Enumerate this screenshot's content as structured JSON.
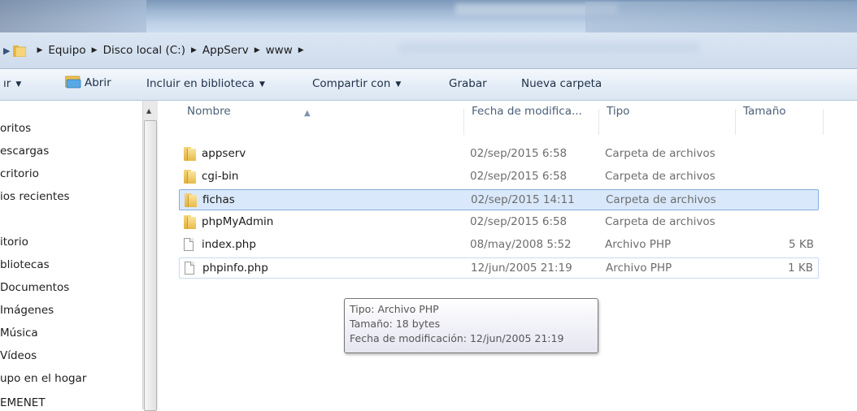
{
  "address": {
    "crumbs": [
      "Equipo",
      "Disco local (C:)",
      "AppServ",
      "www"
    ]
  },
  "toolbar": {
    "organize": "ır",
    "open": "Abrir",
    "include_library": "Incluir en biblioteca",
    "share_with": "Compartir con",
    "burn": "Grabar",
    "new_folder": "Nueva carpeta"
  },
  "nav": [
    "oritos",
    "escargas",
    "critorio",
    "ios recientes",
    "itorio",
    "bliotecas",
    "Documentos",
    "Imágenes",
    "Música",
    "Vídeos",
    "upo en el hogar",
    "EMENET"
  ],
  "columns": {
    "name": "Nombre",
    "date": "Fecha de modifica...",
    "type": "Tipo",
    "size": "Tamaño"
  },
  "files": [
    {
      "name": "appserv",
      "date": "02/sep/2015 6:58",
      "type": "Carpeta de archivos",
      "size": "",
      "icon": "folder-icon"
    },
    {
      "name": "cgi-bin",
      "date": "02/sep/2015 6:58",
      "type": "Carpeta de archivos",
      "size": "",
      "icon": "folder-icon"
    },
    {
      "name": "fichas",
      "date": "02/sep/2015 14:11",
      "type": "Carpeta de archivos",
      "size": "",
      "icon": "folder-icon"
    },
    {
      "name": "phpMyAdmin",
      "date": "02/sep/2015 6:58",
      "type": "Carpeta de archivos",
      "size": "",
      "icon": "folder-icon"
    },
    {
      "name": "index.php",
      "date": "08/may/2008 5:52",
      "type": "Archivo PHP",
      "size": "5 KB",
      "icon": "document-icon"
    },
    {
      "name": "phpinfo.php",
      "date": "12/jun/2005 21:19",
      "type": "Archivo PHP",
      "size": "1 KB",
      "icon": "document-icon"
    }
  ],
  "tooltip": {
    "type": "Tipo: Archivo PHP",
    "size": "Tamaño: 18 bytes",
    "modified": "Fecha de modificación: 12/jun/2005 21:19"
  },
  "colors": {
    "selection": "#d9e8fa",
    "selection_border": "#84acdd",
    "toolbar_text": "#1e3048"
  }
}
